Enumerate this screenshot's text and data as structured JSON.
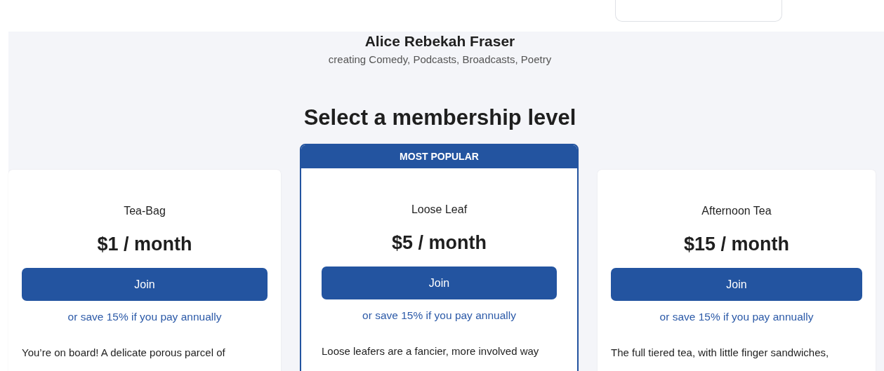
{
  "creator": {
    "name": "Alice Rebekah Fraser",
    "subtitle": "creating Comedy, Podcasts, Broadcasts, Poetry"
  },
  "heading": "Select a membership level",
  "tiers": [
    {
      "name": "Tea-Bag",
      "price": "$1 / month",
      "button": "Join",
      "annual": "or save 15% if you pay annually",
      "description": "You’re on board! A delicate porous parcel of",
      "featured": false
    },
    {
      "name": "Loose Leaf",
      "price": "$5 / month",
      "button": "Join",
      "annual": "or save 15% if you pay annually",
      "description": "Loose leafers are a fancier, more involved way",
      "featured": true,
      "badge": "MOST POPULAR"
    },
    {
      "name": "Afternoon Tea",
      "price": "$15 / month",
      "button": "Join",
      "annual": "or save 15% if you pay annually",
      "description": "The full tiered tea, with little finger sandwiches,",
      "featured": false
    }
  ]
}
